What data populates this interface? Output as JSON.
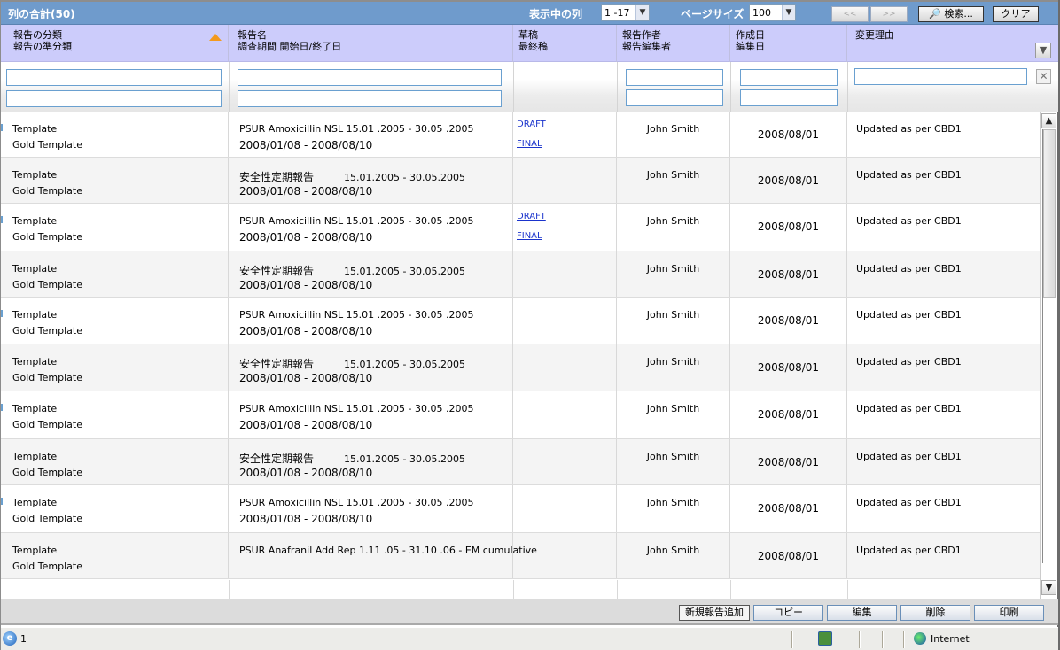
{
  "topbar": {
    "title": "列の合計(50)",
    "columns_label": "表示中の列",
    "columns_value": "1 -17",
    "page_size_label": "ページサイズ",
    "page_size_value": "100",
    "prev_label": "<<",
    "next_label": ">>",
    "search_label": "検索...",
    "clear_label": "クリア"
  },
  "header": {
    "columns": [
      {
        "line1": "報告の分類",
        "line2": "報告の準分類"
      },
      {
        "line1": "報告名",
        "line2": "調査期間  開始日/終了日"
      },
      {
        "line1": "草稿",
        "line2": "最終稿"
      },
      {
        "line1": "報告作者",
        "line2": "報告編集者"
      },
      {
        "line1": "作成日",
        "line2": "編集日"
      },
      {
        "line1": "変更理由",
        "line2": ""
      }
    ]
  },
  "filters": {
    "category": "",
    "subcategory": "",
    "report_name": "",
    "period": "",
    "author": "",
    "editor": "",
    "created": "",
    "edited": "",
    "reason": ""
  },
  "rows": [
    {
      "cat": "Template",
      "sub": "Gold Template",
      "name": "PSUR Amoxicillin NSL 15.01 .2005 - 30.05 .2005",
      "name_jp": "",
      "period": "2008/01/08  -  2008/08/10",
      "draft": "DRAFT",
      "final": "FINAL",
      "author": "John Smith",
      "date": "2008/08/01",
      "reason": "Updated as per CBD1"
    },
    {
      "cat": "Template",
      "sub": "Gold Template",
      "name": "15.01.2005 - 30.05.2005",
      "name_jp": "安全性定期報告",
      "period": "2008/01/08 - 2008/08/10",
      "draft": "",
      "final": "",
      "author": "John Smith",
      "date": "2008/08/01",
      "reason": "Updated as per CBD1"
    },
    {
      "cat": "Template",
      "sub": "Gold Template",
      "name": "PSUR Amoxicillin NSL 15.01 .2005 - 30.05 .2005",
      "name_jp": "",
      "period": "2008/01/08  -  2008/08/10",
      "draft": "DRAFT",
      "final": "FINAL",
      "author": "John Smith",
      "date": "2008/08/01",
      "reason": "Updated as per CBD1"
    },
    {
      "cat": "Template",
      "sub": "Gold Template",
      "name": "15.01.2005 - 30.05.2005",
      "name_jp": "安全性定期報告",
      "period": "2008/01/08 - 2008/08/10",
      "draft": "",
      "final": "",
      "author": "John Smith",
      "date": "2008/08/01",
      "reason": "Updated as per CBD1"
    },
    {
      "cat": "Template",
      "sub": "Gold Template",
      "name": "PSUR Amoxicillin NSL 15.01 .2005 - 30.05 .2005",
      "name_jp": "",
      "period": "2008/01/08  -  2008/08/10",
      "draft": "",
      "final": "",
      "author": "John Smith",
      "date": "2008/08/01",
      "reason": "Updated as per CBD1"
    },
    {
      "cat": "Template",
      "sub": "Gold Template",
      "name": "15.01.2005 - 30.05.2005",
      "name_jp": "安全性定期報告",
      "period": "2008/01/08 - 2008/08/10",
      "draft": "",
      "final": "",
      "author": "John Smith",
      "date": "2008/08/01",
      "reason": "Updated as per CBD1"
    },
    {
      "cat": "Template",
      "sub": "Gold Template",
      "name": "PSUR Amoxicillin NSL 15.01 .2005 - 30.05 .2005",
      "name_jp": "",
      "period": "2008/01/08  -  2008/08/10",
      "draft": "",
      "final": "",
      "author": "John Smith",
      "date": "2008/08/01",
      "reason": "Updated as per CBD1"
    },
    {
      "cat": "Template",
      "sub": "Gold Template",
      "name": "15.01.2005 - 30.05.2005",
      "name_jp": "安全性定期報告",
      "period": "2008/01/08 - 2008/08/10",
      "draft": "",
      "final": "",
      "author": "John Smith",
      "date": "2008/08/01",
      "reason": "Updated as per CBD1"
    },
    {
      "cat": "Template",
      "sub": "Gold Template",
      "name": "PSUR Amoxicillin NSL 15.01 .2005 - 30.05 .2005",
      "name_jp": "",
      "period": "2008/01/08  -  2008/08/10",
      "draft": "",
      "final": "",
      "author": "John Smith",
      "date": "2008/08/01",
      "reason": "Updated as per CBD1"
    },
    {
      "cat": "Template",
      "sub": "Gold Template",
      "name": "PSUR Anafranil Add Rep 1.11 .05 - 31.10 .06 - EM cumulative",
      "name_jp": "",
      "period": "",
      "draft": "",
      "final": "",
      "author": "John Smith",
      "date": "2008/08/01",
      "reason": "Updated as per CBD1"
    }
  ],
  "actions": {
    "add": "新規報告追加",
    "copy": "コピー",
    "edit": "編集",
    "delete": "削除",
    "print": "印刷"
  },
  "status": {
    "page_count": "1",
    "zone": "Internet"
  }
}
